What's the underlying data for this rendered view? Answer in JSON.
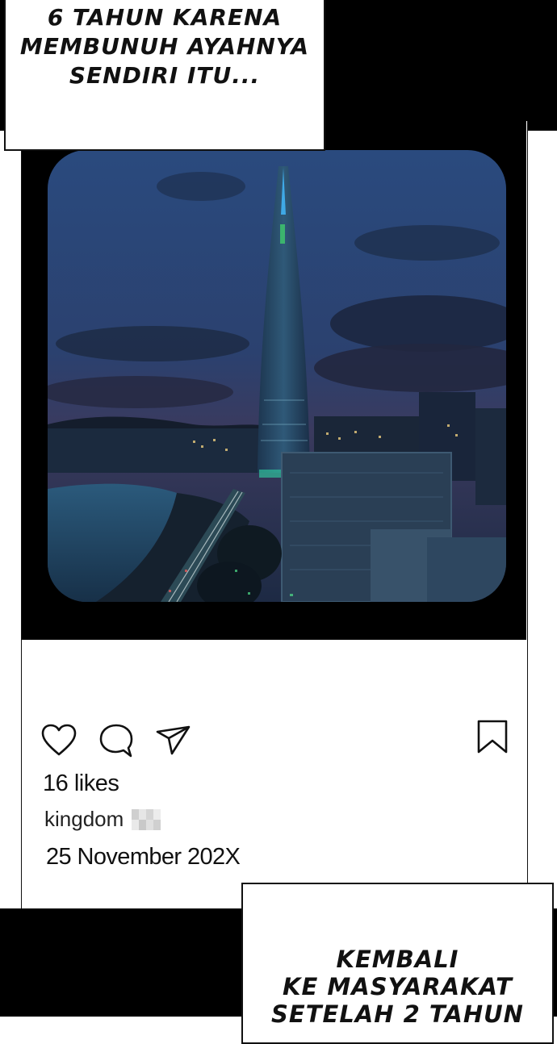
{
  "captions": {
    "top": [
      "6 TAHUN KARENA",
      "MEMBUNUH AYAHNYA",
      "SENDIRI ITU..."
    ],
    "bottom": [
      "KEMBALI",
      "KE MASYARAKAT",
      "SETELAH 2 TAHUN"
    ]
  },
  "post": {
    "likes": "16 likes",
    "username": "kingdom",
    "date": "25 November 202X"
  },
  "icons": {
    "like": "heart-icon",
    "comment": "comment-icon",
    "share": "paper-plane-icon",
    "save": "bookmark-icon"
  }
}
